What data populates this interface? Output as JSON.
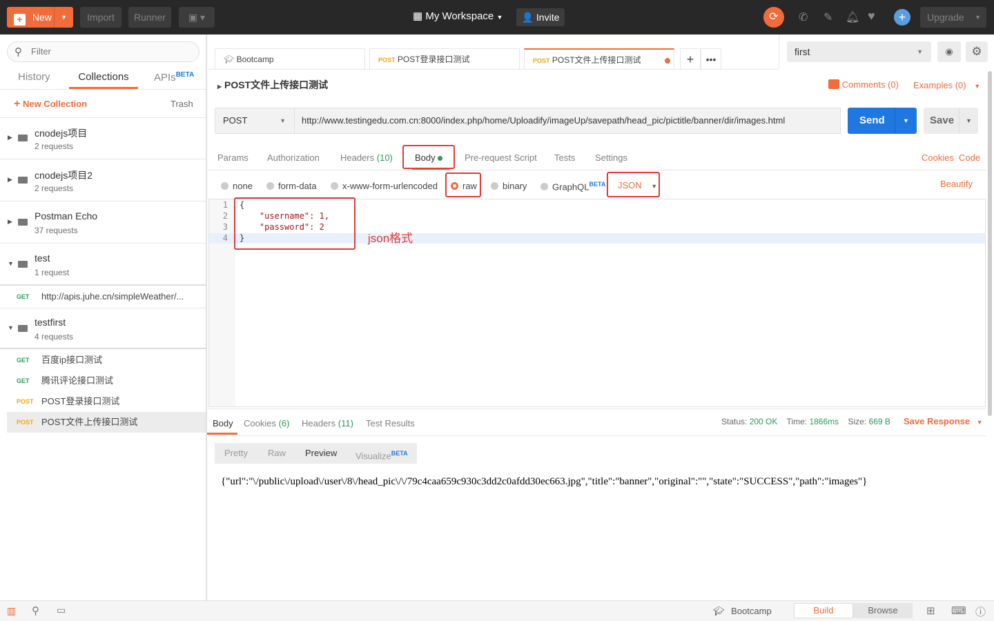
{
  "topbar": {
    "new": "New",
    "import": "Import",
    "runner": "Runner",
    "workspace": "My Workspace",
    "invite": "Invite",
    "upgrade": "Upgrade"
  },
  "sidebar": {
    "filter_placeholder": "Filter",
    "tabs": [
      "History",
      "Collections",
      "APIs"
    ],
    "apis_badge": "BETA",
    "new_collection": "New Collection",
    "trash": "Trash",
    "collections": [
      {
        "name": "cnodejs项目",
        "count": "2 requests"
      },
      {
        "name": "cnodejs项目2",
        "count": "2 requests"
      },
      {
        "name": "Postman Echo",
        "count": "37 requests"
      },
      {
        "name": "test",
        "count": "1 request"
      },
      {
        "name": "testfirst",
        "count": "4 requests"
      }
    ],
    "test_requests": [
      {
        "method": "GET",
        "name": "http://apis.juhe.cn/simpleWeather/..."
      }
    ],
    "testfirst_requests": [
      {
        "method": "GET",
        "name": "百度ip接口测试"
      },
      {
        "method": "GET",
        "name": "腾讯评论接口测试"
      },
      {
        "method": "POST",
        "name": "POST登录接口测试"
      },
      {
        "method": "POST",
        "name": "POST文件上传接口测试"
      }
    ]
  },
  "tabs": [
    {
      "method": "",
      "name": "Bootcamp"
    },
    {
      "method": "POST",
      "name": "POST登录接口测试"
    },
    {
      "method": "POST",
      "name": "POST文件上传接口测试"
    }
  ],
  "environment": "first",
  "request": {
    "title": "POST文件上传接口测试",
    "comments": "Comments (0)",
    "examples": "Examples (0)",
    "method": "POST",
    "url": "http://www.testingedu.com.cn:8000/index.php/home/Uploadify/imageUp/savepath/head_pic/pictitle/banner/dir/images.html",
    "send": "Send",
    "save": "Save",
    "subtabs": {
      "params": "Params",
      "authorization": "Authorization",
      "headers": "Headers",
      "headers_count": "(10)",
      "body": "Body",
      "prerequest": "Pre-request Script",
      "tests": "Tests",
      "settings": "Settings",
      "cookies": "Cookies",
      "code": "Code"
    },
    "body_types": [
      "none",
      "form-data",
      "x-www-form-urlencoded",
      "raw",
      "binary",
      "GraphQL"
    ],
    "graphql_badge": "BETA",
    "format": "JSON",
    "beautify": "Beautify",
    "code_lines": [
      "{",
      "    \"username\": 1,",
      "    \"password\": 2",
      "}"
    ],
    "annotation": "json格式"
  },
  "response": {
    "tabs": {
      "body": "Body",
      "cookies": "Cookies",
      "cookies_count": "(6)",
      "headers": "Headers",
      "headers_count": "(11)",
      "tests": "Test Results"
    },
    "status_label": "Status:",
    "status": "200 OK",
    "time_label": "Time:",
    "time": "1866ms",
    "size_label": "Size:",
    "size": "669 B",
    "save_response": "Save Response",
    "views": [
      "Pretty",
      "Raw",
      "Preview",
      "Visualize"
    ],
    "visualize_badge": "BETA",
    "body": "{\"url\":\"\\/public\\/upload\\/user\\/8\\/head_pic\\/\\/79c4caa659c930c3dd2c0afdd30ec663.jpg\",\"title\":\"banner\",\"original\":\"\",\"state\":\"SUCCESS\",\"path\":\"images\"}"
  },
  "bottombar": {
    "bootcamp": "Bootcamp",
    "build": "Build",
    "browse": "Browse"
  },
  "colors": {
    "accent": "#f26b3a",
    "send": "#1e78e0",
    "green": "#2a9a5a",
    "annotation": "#e53935"
  }
}
